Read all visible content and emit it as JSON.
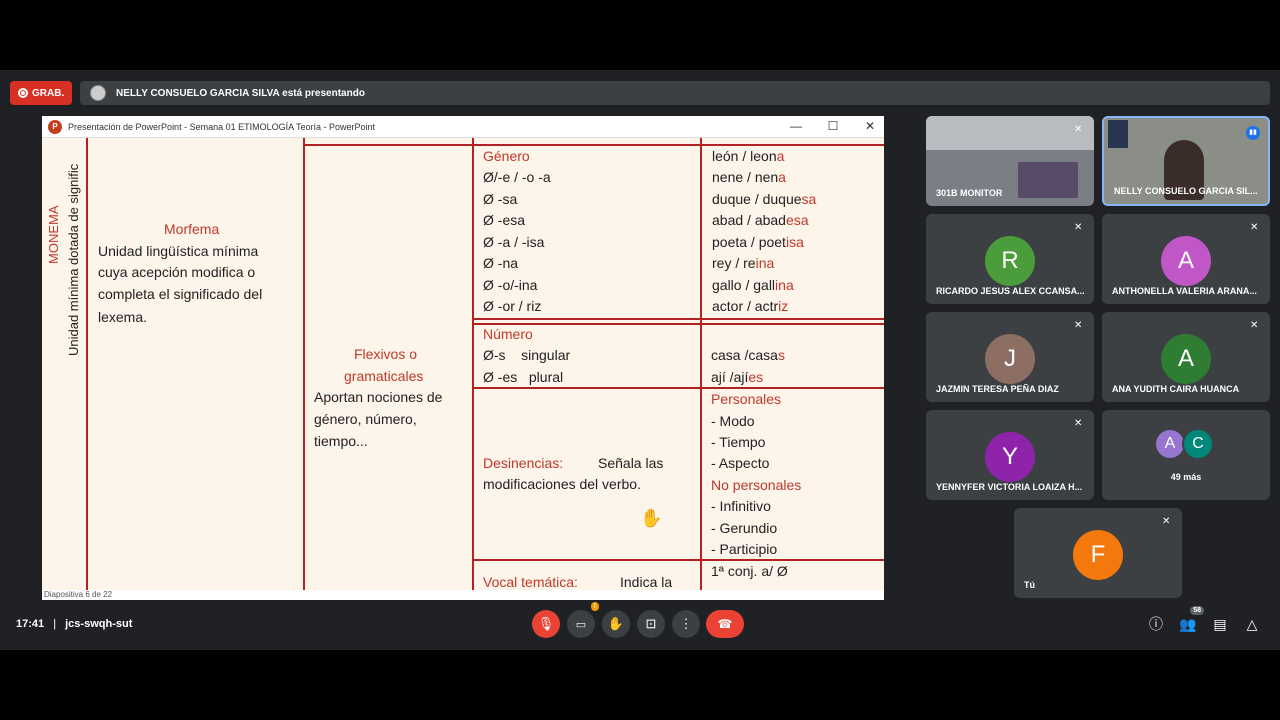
{
  "recording": {
    "label": "GRAB."
  },
  "presenter_bar": {
    "text": "NELLY CONSUELO GARCIA SILVA está presentando"
  },
  "ppt_window": {
    "title": "Presentación de PowerPoint - Semana 01 ETIMOLOGÍA Teoría - PowerPoint",
    "minimize": "—",
    "maximize": "☐",
    "close": "✕",
    "status": "Diapositiva 6 de 22"
  },
  "slide": {
    "vertical_label_1": "MONEMA",
    "vertical_label_2": "Unidad mínima dotada de signific",
    "morfema_title": "Morfema",
    "morfema_desc": [
      "Unidad lingüística mínima",
      "cuya acepción modifica o",
      "completa el significado del",
      "lexema."
    ],
    "flexivos_title_1": "Flexivos o",
    "flexivos_title_2": "gramaticales",
    "flexivos_desc": [
      "Aportan nociones de",
      "género, número,",
      "tiempo..."
    ],
    "genero": {
      "title": "Género",
      "items": [
        "Ø/-e / -o -a",
        "Ø -sa",
        "Ø -esa",
        "Ø -a / -isa",
        "Ø -na",
        "Ø -o/-ina",
        "Ø -or / riz"
      ],
      "examples": [
        [
          "león / leon",
          "a"
        ],
        [
          "nene / nen",
          "a"
        ],
        [
          "duque / duque",
          "sa"
        ],
        [
          "abad / abad",
          "esa"
        ],
        [
          "poeta / poet",
          "isa"
        ],
        [
          "rey / re",
          "ina"
        ],
        [
          "gallo / gall",
          "ina"
        ],
        [
          "actor / actr",
          "iz"
        ]
      ]
    },
    "numero": {
      "title": "Número",
      "items": [
        "Ø-s    singular",
        "Ø -es   plural"
      ],
      "examples": [
        [
          "casa /casa",
          "s"
        ],
        [
          "ají /ají",
          "es"
        ]
      ]
    },
    "desinencias": {
      "title": "Desinencias:",
      "desc_1": "Señala las",
      "desc_2": "modificaciones del verbo.",
      "personales": "Personales",
      "personales_items": [
        "- Modo",
        "- Tiempo",
        "- Aspecto"
      ],
      "no_personales": "No personales",
      "no_personales_items": [
        "- Infinitivo",
        "- Gerundio",
        "- Participio"
      ]
    },
    "vocal": {
      "title": "Vocal temática:",
      "desc": "Indica la",
      "example": "1ª conj. a/ Ø"
    }
  },
  "participants": [
    {
      "name": "301B MONITOR",
      "type": "video"
    },
    {
      "name": "NELLY CONSUELO GARCIA SIL...",
      "type": "video"
    },
    {
      "name": "RICARDO JESUS ALEX CCANSA...",
      "initial": "R",
      "color": "#4a9d3a"
    },
    {
      "name": "ANTHONELLA VALERIA ARANA...",
      "initial": "A",
      "color": "#c157c6"
    },
    {
      "name": "JAZMIN TERESA PEÑA DIAZ",
      "initial": "J",
      "color": "#8d6e63"
    },
    {
      "name": "ANA YUDITH CAIRA HUANCA",
      "initial": "A",
      "color": "#2e7d32"
    },
    {
      "name": "YENNYFER VICTORIA LOAIZA H...",
      "initial": "Y",
      "color": "#8e24aa"
    },
    {
      "name": "49 más",
      "initials": [
        "A",
        "C"
      ],
      "colors": [
        "#9575cd",
        "#00897b"
      ]
    },
    {
      "name": "Tú",
      "initial": "F",
      "color": "#f4780b"
    }
  ],
  "bottom": {
    "time": "17:41",
    "separator": "|",
    "meeting_code": "jcs-swqh-sut",
    "people_count": "58",
    "camera_badge": "!"
  }
}
